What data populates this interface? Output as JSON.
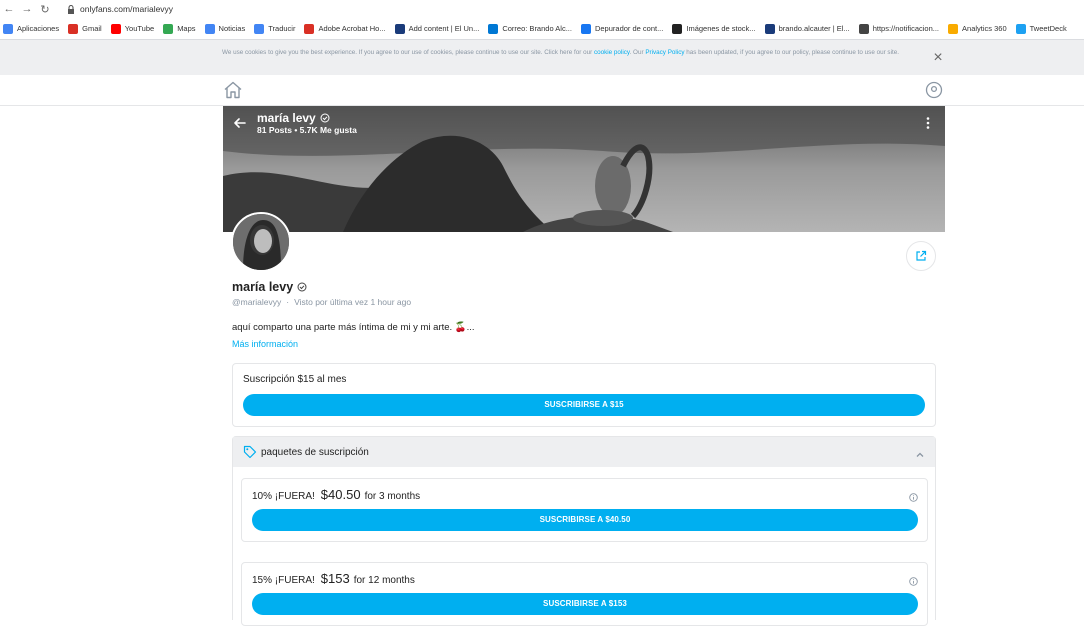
{
  "browser": {
    "url": "onlyfans.com/marialevyy",
    "bookmarks": [
      {
        "label": "Aplicaciones",
        "icon": "apps-grid-icon",
        "color": "#4285f4"
      },
      {
        "label": "Gmail",
        "icon": "gmail-icon",
        "color": "#d93025"
      },
      {
        "label": "YouTube",
        "icon": "youtube-icon",
        "color": "#ff0000"
      },
      {
        "label": "Maps",
        "icon": "maps-pin-icon",
        "color": "#34a853"
      },
      {
        "label": "Noticias",
        "icon": "news-icon",
        "color": "#4285f4"
      },
      {
        "label": "Traducir",
        "icon": "translate-icon",
        "color": "#4285f4"
      },
      {
        "label": "Adobe Acrobat Ho...",
        "icon": "acrobat-icon",
        "color": "#d93025"
      },
      {
        "label": "Add content | El Un...",
        "icon": "el-universal-icon",
        "color": "#1a3b7a"
      },
      {
        "label": "Correo: Brando Alc...",
        "icon": "outlook-icon",
        "color": "#0078d4"
      },
      {
        "label": "Depurador de cont...",
        "icon": "facebook-icon",
        "color": "#1877f2"
      },
      {
        "label": "Imágenes de stock...",
        "icon": "shutterstock-icon",
        "color": "#222222"
      },
      {
        "label": "brando.alcauter | El...",
        "icon": "el-universal-icon",
        "color": "#1a3b7a"
      },
      {
        "label": "https://notificacion...",
        "icon": "globe-icon",
        "color": "#444444"
      },
      {
        "label": "Analytics 360",
        "icon": "analytics-icon",
        "color": "#f9ab00"
      },
      {
        "label": "TweetDeck",
        "icon": "tweetdeck-icon",
        "color": "#1da1f2"
      }
    ]
  },
  "cookie_banner": {
    "text_before": "We use cookies to give you the best experience. If you agree to our use of cookies, please continue to use our site. Click here for our ",
    "cookie_link": "cookie policy",
    "text_middle": ". Our ",
    "privacy_link": "Privacy Policy",
    "text_after": " has been updated, if you agree to our policy, please continue to use our site.",
    "close": "×"
  },
  "banner": {
    "name": "maría levy",
    "stats": "81 Posts  •  5.7K Me gusta"
  },
  "profile": {
    "name": "maría levy",
    "handle": "@marialevyy",
    "dot": "·",
    "last_seen": "Visto por última vez 1 hour ago",
    "bio": "aquí comparto una parte más íntima de mi y mi arte. 🍒...",
    "more_info": "Más información"
  },
  "subscription": {
    "title": "Suscripción $15 al mes",
    "button": "SUSCRIBIRSE A $15"
  },
  "bundles": {
    "title": "paquetes de suscripción",
    "items": [
      {
        "discount": "10% ¡FUERA!",
        "price": "$40.50",
        "period": "for 3 months",
        "button": "SUSCRIBIRSE A $40.50"
      },
      {
        "discount": "15% ¡FUERA!",
        "price": "$153",
        "period": "for 12 months",
        "button": "SUSCRIBIRSE A $153"
      }
    ]
  },
  "colors": {
    "accent": "#00aff0",
    "muted": "#8a96a3",
    "border": "#e5e6e8"
  }
}
